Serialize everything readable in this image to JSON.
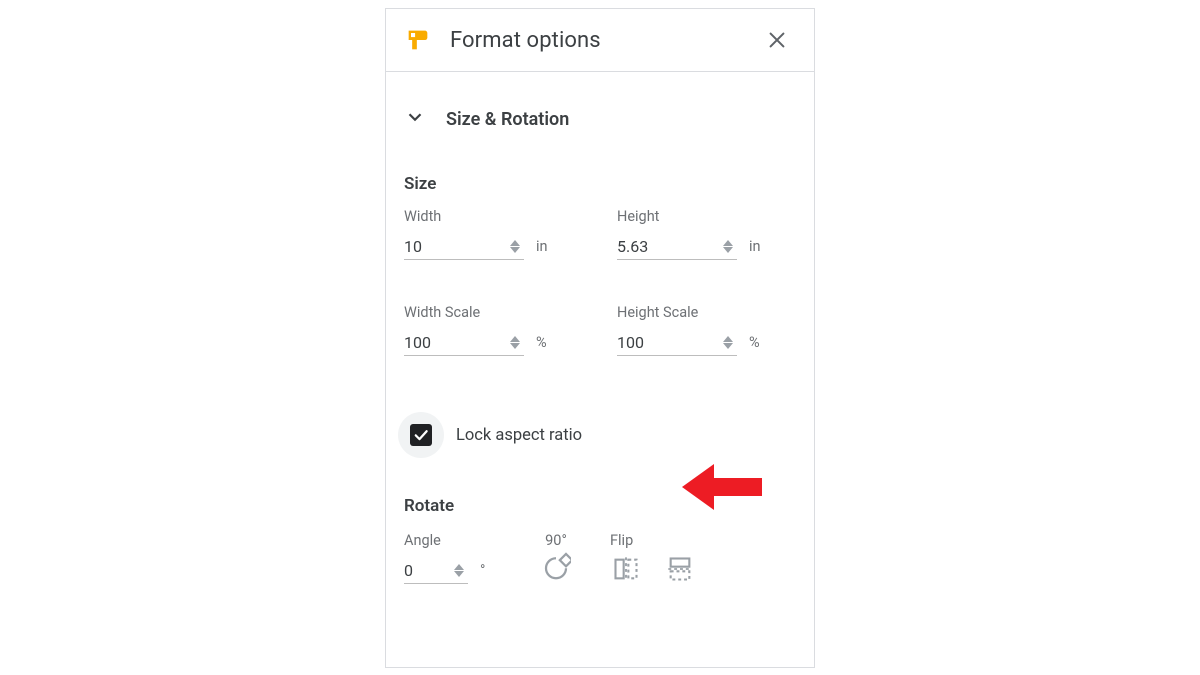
{
  "header": {
    "title": "Format options"
  },
  "section": {
    "title": "Size & Rotation"
  },
  "size": {
    "heading": "Size",
    "width_label": "Width",
    "width_value": "10",
    "width_unit": "in",
    "height_label": "Height",
    "height_value": "5.63",
    "height_unit": "in",
    "width_scale_label": "Width Scale",
    "width_scale_value": "100",
    "width_scale_unit": "%",
    "height_scale_label": "Height Scale",
    "height_scale_value": "100",
    "height_scale_unit": "%",
    "lock_label": "Lock aspect ratio",
    "lock_checked": true
  },
  "rotate": {
    "heading": "Rotate",
    "angle_label": "Angle",
    "angle_value": "0",
    "angle_unit": "°",
    "ninety_label": "90°",
    "flip_label": "Flip"
  }
}
